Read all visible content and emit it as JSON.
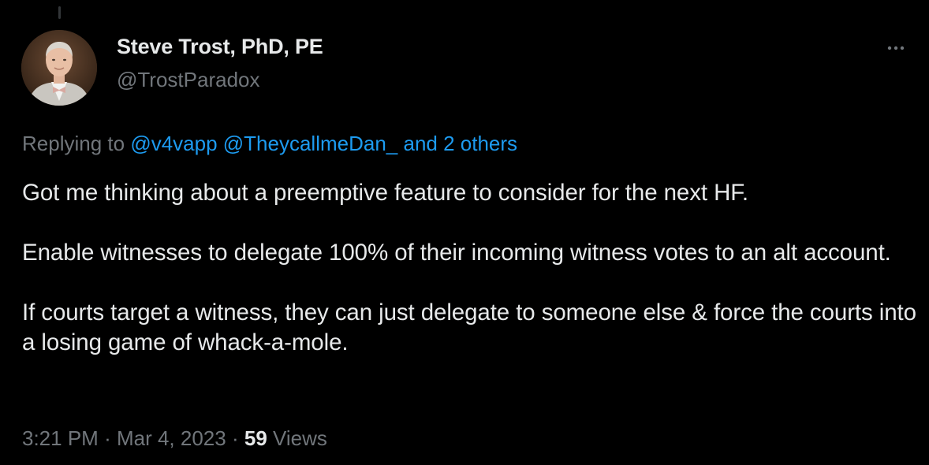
{
  "author": {
    "display_name": "Steve Trost, PhD, PE",
    "handle": "@TrostParadox"
  },
  "reply": {
    "prefix": "Replying to",
    "mentions": [
      "@v4vapp",
      "@TheycallmeDan_"
    ],
    "others": "and 2 others"
  },
  "tweet": {
    "paragraphs": [
      "Got me thinking about a preemptive feature to consider for the next HF.",
      "Enable witnesses to delegate 100% of their incoming witness votes to an alt account.",
      "If courts target a witness, they can just delegate to someone else & force the courts into a losing game of whack-a-mole."
    ]
  },
  "meta": {
    "time": "3:21 PM",
    "separator": "·",
    "date": "Mar 4, 2023",
    "views_count": "59",
    "views_label": "Views"
  },
  "icons": {
    "more": "more-horizontal-icon"
  },
  "colors": {
    "background": "#000000",
    "text": "#e7e9ea",
    "secondary": "#71767b",
    "link": "#1d9bf0"
  }
}
